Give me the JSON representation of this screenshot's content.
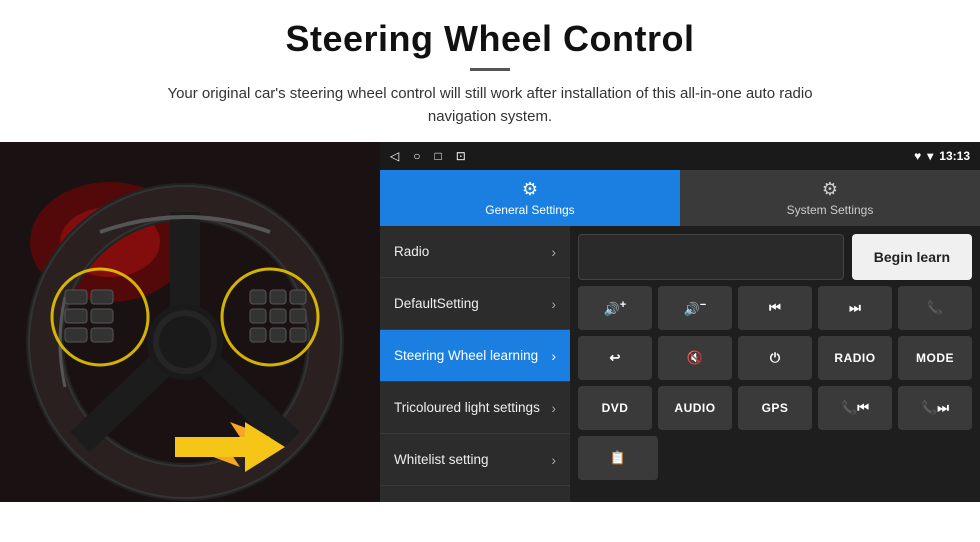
{
  "header": {
    "title": "Steering Wheel Control",
    "subtitle": "Your original car's steering wheel control will still work after installation of this all-in-one auto radio navigation system."
  },
  "status_bar": {
    "nav_icons": [
      "◁",
      "○",
      "□",
      "⊡"
    ],
    "time": "13:13",
    "signal_icons": "♥ ▾"
  },
  "tabs": [
    {
      "id": "general",
      "label": "General Settings",
      "icon": "⚙",
      "active": true
    },
    {
      "id": "system",
      "label": "System Settings",
      "icon": "⚙",
      "active": false
    }
  ],
  "settings_menu": [
    {
      "label": "Radio",
      "active": false
    },
    {
      "label": "DefaultSetting",
      "active": false
    },
    {
      "label": "Steering Wheel learning",
      "active": true
    },
    {
      "label": "Tricoloured light settings",
      "active": false
    },
    {
      "label": "Whitelist setting",
      "active": false
    }
  ],
  "controls": {
    "begin_learn_label": "Begin learn",
    "buttons_row1": [
      {
        "label": "🔊+",
        "icon": true
      },
      {
        "label": "🔊−",
        "icon": true
      },
      {
        "label": "⏮",
        "icon": true
      },
      {
        "label": "⏭",
        "icon": true
      },
      {
        "label": "📞",
        "icon": true
      }
    ],
    "buttons_row2": [
      {
        "label": "↩",
        "icon": true
      },
      {
        "label": "🔊×",
        "icon": true
      },
      {
        "label": "⏻",
        "icon": true
      },
      {
        "label": "RADIO",
        "icon": false
      },
      {
        "label": "MODE",
        "icon": false
      }
    ],
    "buttons_row3": [
      {
        "label": "DVD",
        "icon": false
      },
      {
        "label": "AUDIO",
        "icon": false
      },
      {
        "label": "GPS",
        "icon": false
      },
      {
        "label": "📞⏮",
        "icon": true
      },
      {
        "label": "📞⏭",
        "icon": true
      }
    ],
    "buttons_row4": [
      {
        "label": "📋",
        "icon": true
      }
    ]
  }
}
